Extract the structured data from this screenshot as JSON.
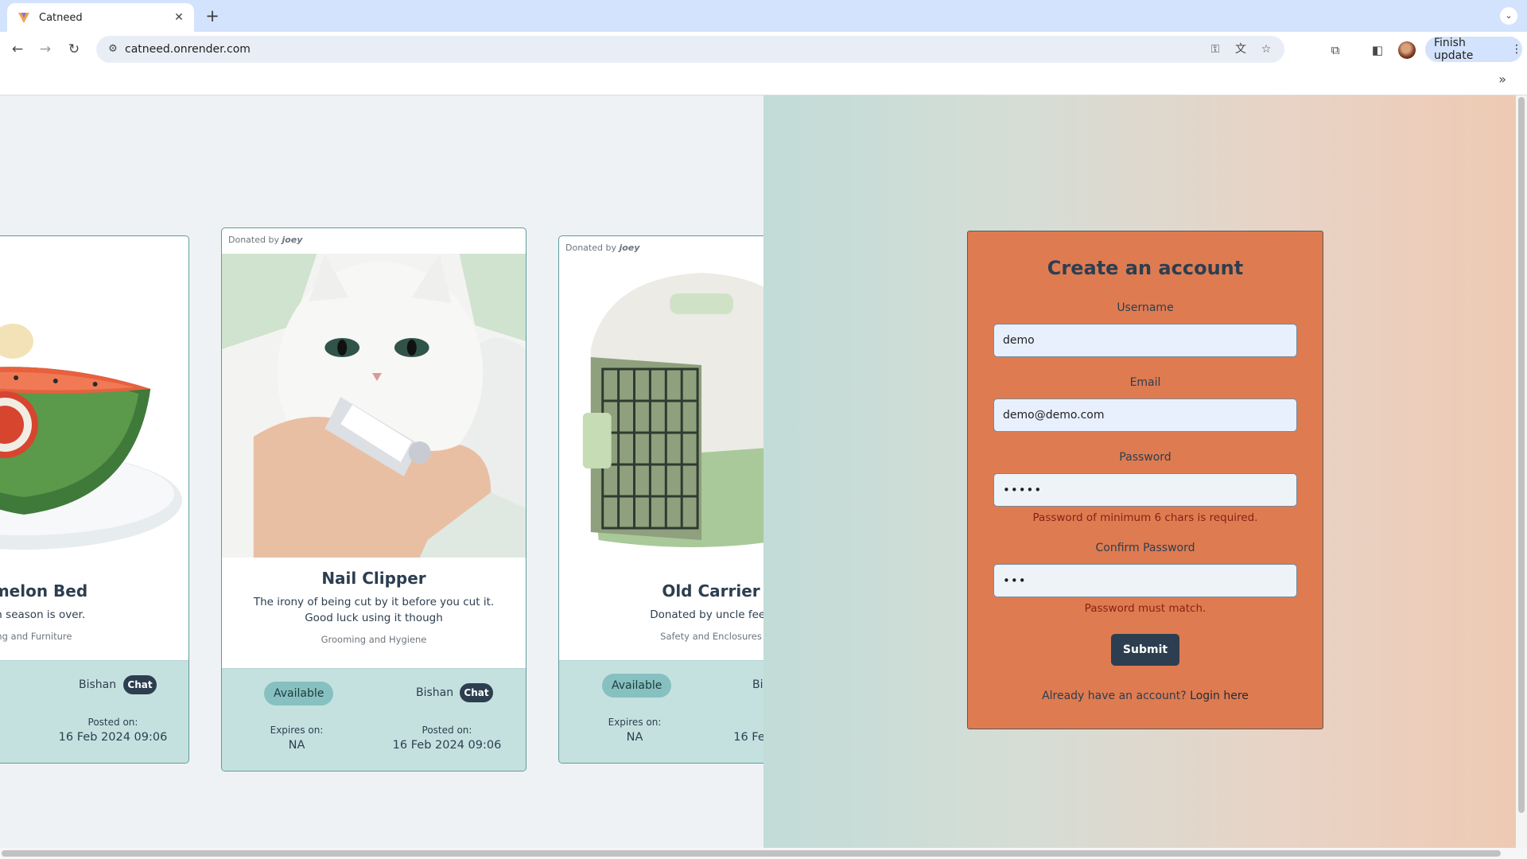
{
  "browser": {
    "tab_title": "Catneed",
    "url": "catneed.onrender.com",
    "finish_update_label": "Finish update",
    "chevrons": "»"
  },
  "cards": [
    {
      "donor_prefix": "",
      "donor_name": "",
      "title": "termelon Bed",
      "description": "melon season is over.",
      "category": "dding and Furniture",
      "status": "",
      "location": "Bishan",
      "chat_label": "Chat",
      "expires_label": "",
      "expires_value": "",
      "posted_label": "Posted on:",
      "posted_value": "16 Feb 2024 09:06"
    },
    {
      "donor_prefix": "Donated by",
      "donor_name": "joey",
      "title": "Nail Clipper",
      "description": "The irony of being cut by it before you cut it. Good luck using it though",
      "category": "Grooming and Hygiene",
      "status": "Available",
      "location": "Bishan",
      "chat_label": "Chat",
      "expires_label": "Expires on:",
      "expires_value": "NA",
      "posted_label": "Posted on:",
      "posted_value": "16 Feb 2024 09:06"
    },
    {
      "donor_prefix": "Donated by",
      "donor_name": "joey",
      "title": "Old Carrier",
      "description": "Donated by uncle feed",
      "category": "Safety and Enclosures",
      "status": "Available",
      "location": "Bi",
      "chat_label": "",
      "expires_label": "Expires on:",
      "expires_value": "NA",
      "posted_label": "",
      "posted_value": "16 Fe"
    }
  ],
  "signup": {
    "title": "Create an account",
    "username_label": "Username",
    "username_value": "demo",
    "email_label": "Email",
    "email_value": "demo@demo.com",
    "password_label": "Password",
    "password_value": "•••••",
    "password_error": "Password of minimum 6 chars is required.",
    "confirm_label": "Confirm Password",
    "confirm_value": "•••",
    "confirm_error": "Password must match.",
    "submit_label": "Submit",
    "login_prompt": "Already have an account?",
    "login_link": "Login here"
  },
  "colors": {
    "form_bg": "#de7b51",
    "primary_dark": "#2c3e50",
    "card_footer": "#c5e1df",
    "badge_available": "#87c0c0",
    "error_text": "#8b1e12"
  }
}
